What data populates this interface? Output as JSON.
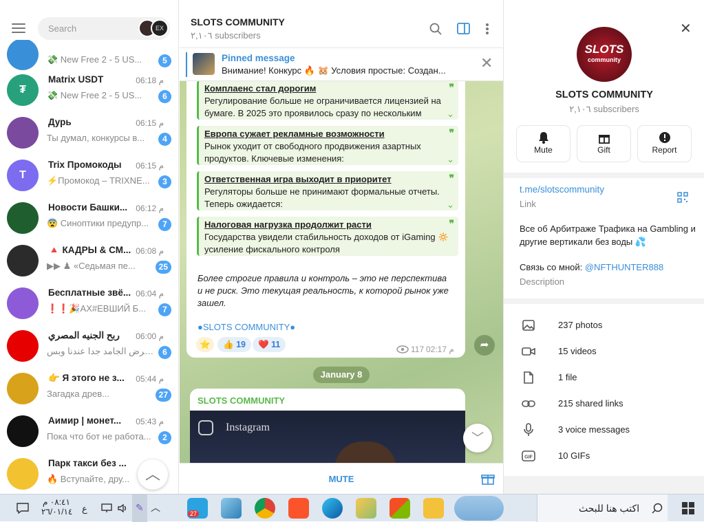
{
  "left": {
    "search_placeholder": "Search",
    "chats": [
      {
        "name": "",
        "time": "",
        "preview": "💸 New Free 2 - 5 US...",
        "badge": "5",
        "avatar_color": "#3a8fd9",
        "avatar_text": ""
      },
      {
        "name": "Matrix USDT",
        "time": "06:18 م",
        "preview": "💸 New Free 2 - 5 US...",
        "badge": "6",
        "avatar_color": "#26a17b",
        "avatar_text": "₮"
      },
      {
        "name": "Дурь",
        "time": "06:15 م",
        "preview": "Ты думал, конкурсы в...",
        "badge": "4",
        "avatar_color": "#7a4a9e",
        "avatar_text": ""
      },
      {
        "name": "Trix Промокоды",
        "time": "06:15 م",
        "preview": "⚡Промокод – TRIXNE...",
        "badge": "3",
        "avatar_color": "#7b6cf0",
        "avatar_text": "T"
      },
      {
        "name": "Новости Башки...",
        "time": "06:12 م",
        "preview": "😨 Синоптики предупр...",
        "badge": "7",
        "avatar_color": "#1f5f2f",
        "avatar_text": ""
      },
      {
        "name": "🔺 КАДРЫ & СМ...",
        "time": "06:08 م",
        "preview": "▶▶ ♟ «Седьмая пе...",
        "badge": "25",
        "avatar_color": "#2b2b2b",
        "avatar_text": ""
      },
      {
        "name": "Бесплатные звё...",
        "time": "06:04 م",
        "preview": "❗❗🎉АХ#ЕВШИЙ Б...",
        "badge": "7",
        "avatar_color": "#8e5bd8",
        "avatar_text": ""
      },
      {
        "name": "ربح الجنيه المصري",
        "time": "06:00 م",
        "preview": "العرض الجامد جدا عندنا وبس...",
        "badge": "6",
        "avatar_color": "#e60000",
        "avatar_text": ""
      },
      {
        "name": "👉 Я этого не з...",
        "time": "05:44 م",
        "preview": "Загадка древ...",
        "badge": "27",
        "avatar_color": "#d8a21a",
        "avatar_text": ""
      },
      {
        "name": "Аимир | монет...",
        "time": "05:43 م",
        "preview": "Пока что бот не работа...",
        "badge": "2",
        "avatar_color": "#111111",
        "avatar_text": ""
      },
      {
        "name": "Парк такси без ...",
        "time": "",
        "preview": "🔥 Вступайте, дру...",
        "badge": "",
        "avatar_color": "#f2c230",
        "avatar_text": ""
      }
    ]
  },
  "header": {
    "title": "SLOTS COMMUNITY",
    "subtitle": "٢,١٠٦ subscribers"
  },
  "pinned": {
    "label": "Pinned message",
    "text": "Внимание! Конкурс 🔥 🐹 Условия простые:  Создан..."
  },
  "message": {
    "quotes": [
      {
        "title": "Комплаенс стал дорогим",
        "body": "Регулирование больше не ограничивается лицензией на бумаге. В 2025 это проявилось сразу по нескольким"
      },
      {
        "title": "Европа сужает рекламные возможности",
        "body": "Рынок уходит от свободного продвижения азартных продуктов. Ключевые изменения:"
      },
      {
        "title": "Ответственная игра выходит в приоритет",
        "body": "Регуляторы больше не принимают формальные отчеты. Теперь ожидается:"
      },
      {
        "title": "Налоговая нагрузка продолжит расти",
        "body": "Государства увидели стабильность доходов от iGaming 🔅 усиление фискального контроля"
      }
    ],
    "italic": "Более строгие правила и контроль – это не перспектива и не риск. Это текущая реальность, к которой рынок уже зашел.",
    "signature": "SLOTS COMMUNITY",
    "reactions": [
      {
        "emoji": "⭐",
        "count": ""
      },
      {
        "emoji": "👍",
        "count": "19"
      },
      {
        "emoji": "❤️",
        "count": "11"
      }
    ],
    "views": "117",
    "time": "02:17 م"
  },
  "date_chip": "January 8",
  "message2": {
    "sender": "SLOTS COMMUNITY",
    "image_text": "Instagram"
  },
  "mute_label": "MUTE",
  "profile": {
    "name": "SLOTS COMMUNITY",
    "subs": "٢,١٠٦ subscribers",
    "avatar_text": "SLOTS",
    "avatar_sub": "community",
    "actions": [
      "Mute",
      "Gift",
      "Report"
    ],
    "link": "t.me/slotscommunity",
    "link_label": "Link",
    "description": "Все об Арбитраже Трафика на Gambling и другие вертикали без воды 💦",
    "contact_prefix": "Связь со мной: ",
    "contact_handle": "@NFTHUNTER888",
    "description_label": "Description",
    "media": [
      "237 photos",
      "15 videos",
      "1 file",
      "215 shared links",
      "3 voice messages",
      "10 GIFs"
    ]
  },
  "taskbar": {
    "search_text": "اكتب هنا للبحث",
    "clock_time": "٠٨:٤١ م",
    "clock_date": "٢٦/٠١/١٤",
    "lang": "ع",
    "telegram_badge": "27"
  }
}
